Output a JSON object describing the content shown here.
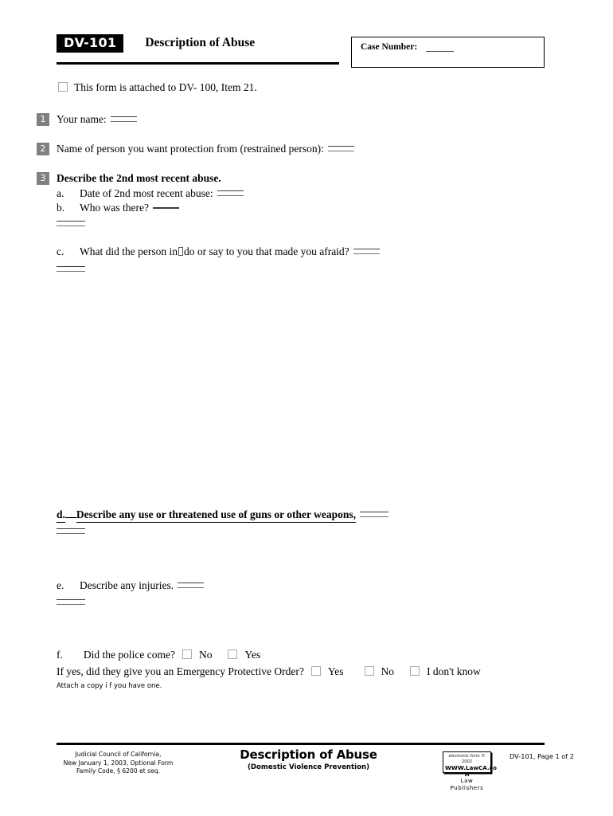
{
  "header": {
    "form_badge": "DV-101",
    "form_title": "Description of Abuse",
    "case_number_label": "Case Number:"
  },
  "attached_notice": {
    "text": "This form is attached to DV- 100, Item 21."
  },
  "items": [
    {
      "number": "1",
      "label": "Your name:"
    },
    {
      "number": "2",
      "label": "Name of person you want protection from (restrained person):"
    },
    {
      "number": "3",
      "label": "Describe the 2nd most recent abuse.",
      "subitems": [
        {
          "letter": "a.",
          "text": "Date of 2nd most recent abuse:"
        },
        {
          "letter": "b.",
          "text": "Who was there?"
        },
        {
          "letter": "c.",
          "text_before": "What did the person in",
          "text_after": "do or say to you that made you afraid?"
        },
        {
          "letter": "d.",
          "text": "Describe any use or threatened use of guns or other weapons,"
        },
        {
          "letter": "e.",
          "text": "Describe any injuries."
        },
        {
          "letter": "f.",
          "text": "Did the police come?"
        }
      ]
    }
  ],
  "police_question": {
    "letter": "f.",
    "question": "Did the police come?",
    "option_no": "No",
    "option_yes": "Yes"
  },
  "epo_question": {
    "question": "If yes, did they give you an Emergency Protective Order?",
    "option_yes": "Yes",
    "option_no": "No",
    "option_dont_know": "I don't know",
    "note": "Attach a copy i f you have one."
  },
  "footer": {
    "left_line1": "Judicial Council of California,",
    "left_line2": "New January 1, 2003, Optional Form",
    "left_line3": "Family Code, § 6200 et seq.",
    "center_title": "Description of Abuse",
    "center_subtitle": "(Domestic Violence Prevention)",
    "logo_line1": "electronic form ©",
    "logo_line2": "2002",
    "logo_line3": "WWW.LawCA.co",
    "logo_line4": "m",
    "logo_tag1": "Law",
    "logo_tag2": "Publishers",
    "page_label": "DV-101, Page 1 of 2"
  },
  "colors": {
    "badge_bg": "#000000",
    "num_badge_bg": "#808080",
    "rule": "#000000",
    "checkbox_border": "#aaaaaa"
  }
}
